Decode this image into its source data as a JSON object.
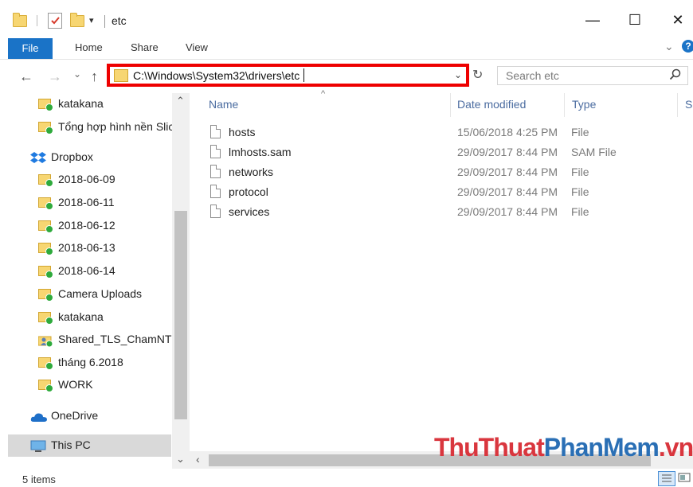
{
  "window": {
    "title": "etc",
    "minimize": "—",
    "maximize": "☐",
    "close": "✕"
  },
  "ribbon": {
    "tabs": [
      "File",
      "Home",
      "Share",
      "View"
    ],
    "collapse": "⌄",
    "help": "?"
  },
  "address": {
    "back": "←",
    "forward": "→",
    "recent": "⌄",
    "up": "↑",
    "path": "C:\\Windows\\System32\\drivers\\etc",
    "dropdown": "⌄",
    "refresh": "↻",
    "search_placeholder": "Search etc"
  },
  "nav": {
    "items": [
      {
        "label": "katakana",
        "icon": "folder-synced-icon"
      },
      {
        "label": "Tổng hợp hình nền Slic",
        "icon": "folder-synced-icon"
      },
      {
        "label": "Dropbox",
        "icon": "dropbox-icon"
      },
      {
        "label": "2018-06-09",
        "icon": "folder-synced-icon"
      },
      {
        "label": "2018-06-11",
        "icon": "folder-synced-icon"
      },
      {
        "label": "2018-06-12",
        "icon": "folder-synced-icon"
      },
      {
        "label": "2018-06-13",
        "icon": "folder-synced-icon"
      },
      {
        "label": "2018-06-14",
        "icon": "folder-synced-icon"
      },
      {
        "label": "Camera Uploads",
        "icon": "folder-synced-icon"
      },
      {
        "label": "katakana",
        "icon": "folder-synced-icon"
      },
      {
        "label": "Shared_TLS_ChamNT",
        "icon": "shared-folder-icon"
      },
      {
        "label": "tháng 6.2018",
        "icon": "folder-synced-icon"
      },
      {
        "label": "WORK",
        "icon": "folder-synced-icon"
      },
      {
        "label": "OneDrive",
        "icon": "onedrive-icon"
      },
      {
        "label": "This PC",
        "icon": "computer-icon"
      }
    ],
    "scroll_up": "⌃",
    "scroll_down": "⌄"
  },
  "columns": {
    "name": "Name",
    "date": "Date modified",
    "type": "Type",
    "size": "Si"
  },
  "files": [
    {
      "name": "hosts",
      "date": "15/06/2018 4:25 PM",
      "type": "File"
    },
    {
      "name": "lmhosts.sam",
      "date": "29/09/2017 8:44 PM",
      "type": "SAM File"
    },
    {
      "name": "networks",
      "date": "29/09/2017 8:44 PM",
      "type": "File"
    },
    {
      "name": "protocol",
      "date": "29/09/2017 8:44 PM",
      "type": "File"
    },
    {
      "name": "services",
      "date": "29/09/2017 8:44 PM",
      "type": "File"
    }
  ],
  "status": {
    "count": "5 items"
  },
  "watermark": {
    "part1": "ThuThuat",
    "part2": "PhanMem",
    "part3": ".vn"
  },
  "colors": {
    "accent": "#1a73c7",
    "highlight_border": "#e00000",
    "watermark_red": "#d9363e",
    "watermark_blue": "#2a6fb5"
  }
}
